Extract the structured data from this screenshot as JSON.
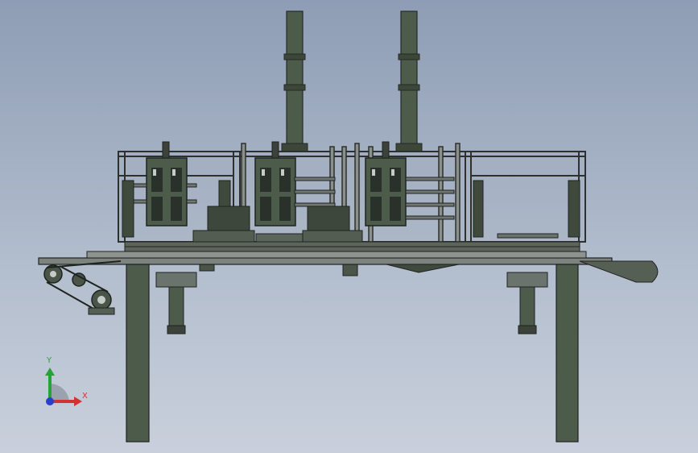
{
  "axes": {
    "y_label": "Y",
    "x_label": "X"
  },
  "colors": {
    "background_top": "#8e9db5",
    "background_bottom": "#c9d0dc",
    "machine_green": "#4c5a49",
    "machine_dark": "#2d302d",
    "steel": "#9a9e9c",
    "axis_y": "#26a23a",
    "axis_x": "#d23232",
    "axis_z": "#2a3fc9"
  }
}
